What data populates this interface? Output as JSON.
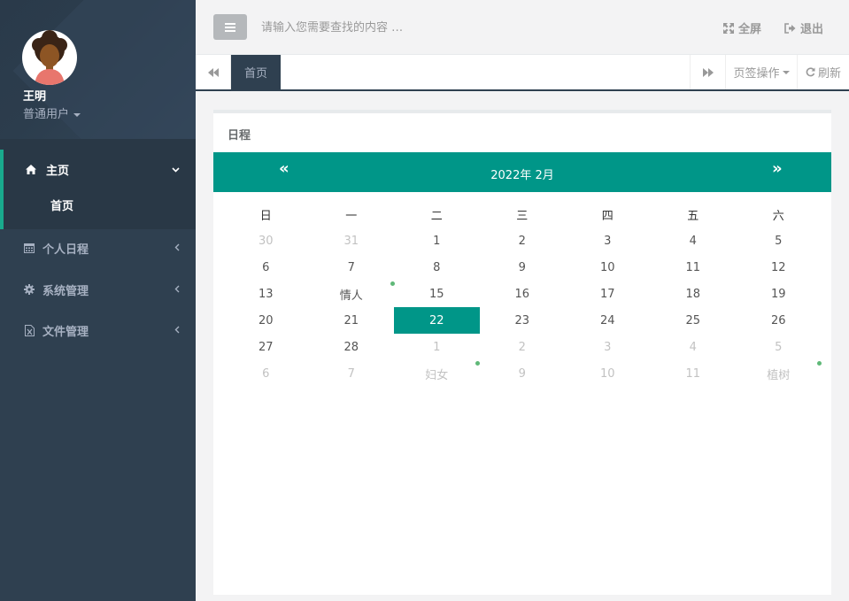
{
  "sidebar": {
    "user_name": "王明",
    "user_role": "普通用户",
    "nav": [
      {
        "label": "主页",
        "icon": "home-icon",
        "open": true,
        "children": [
          {
            "label": "首页"
          }
        ]
      },
      {
        "label": "个人日程",
        "icon": "calendar-icon"
      },
      {
        "label": "系统管理",
        "icon": "gear-icon"
      },
      {
        "label": "文件管理",
        "icon": "file-icon"
      }
    ]
  },
  "topbar": {
    "search_placeholder": "请输入您需要查找的内容 …",
    "fullscreen_label": "全屏",
    "logout_label": "退出"
  },
  "tabs": {
    "home_label": "首页",
    "ops_label": "页签操作",
    "refresh_label": "刷新"
  },
  "panel": {
    "title": "日程"
  },
  "calendar": {
    "title": "2022年  2月",
    "prev_glyph": "«",
    "next_glyph": "»",
    "accent_color": "#009688",
    "weekdays": [
      "日",
      "一",
      "二",
      "三",
      "四",
      "五",
      "六"
    ],
    "weeks": [
      [
        {
          "t": "30",
          "o": true
        },
        {
          "t": "31",
          "o": true
        },
        {
          "t": "1"
        },
        {
          "t": "2"
        },
        {
          "t": "3"
        },
        {
          "t": "4"
        },
        {
          "t": "5"
        }
      ],
      [
        {
          "t": "6"
        },
        {
          "t": "7"
        },
        {
          "t": "8"
        },
        {
          "t": "9"
        },
        {
          "t": "10"
        },
        {
          "t": "11"
        },
        {
          "t": "12"
        }
      ],
      [
        {
          "t": "13"
        },
        {
          "t": "情人",
          "mark": true
        },
        {
          "t": "15"
        },
        {
          "t": "16"
        },
        {
          "t": "17"
        },
        {
          "t": "18"
        },
        {
          "t": "19"
        }
      ],
      [
        {
          "t": "20"
        },
        {
          "t": "21"
        },
        {
          "t": "22",
          "today": true
        },
        {
          "t": "23"
        },
        {
          "t": "24"
        },
        {
          "t": "25"
        },
        {
          "t": "26"
        }
      ],
      [
        {
          "t": "27"
        },
        {
          "t": "28"
        },
        {
          "t": "1",
          "o": true
        },
        {
          "t": "2",
          "o": true
        },
        {
          "t": "3",
          "o": true
        },
        {
          "t": "4",
          "o": true
        },
        {
          "t": "5",
          "o": true
        }
      ],
      [
        {
          "t": "6",
          "o": true
        },
        {
          "t": "7",
          "o": true
        },
        {
          "t": "妇女",
          "o": true,
          "mark": true
        },
        {
          "t": "9",
          "o": true
        },
        {
          "t": "10",
          "o": true
        },
        {
          "t": "11",
          "o": true
        },
        {
          "t": "植树",
          "o": true,
          "mark": true
        }
      ]
    ]
  }
}
